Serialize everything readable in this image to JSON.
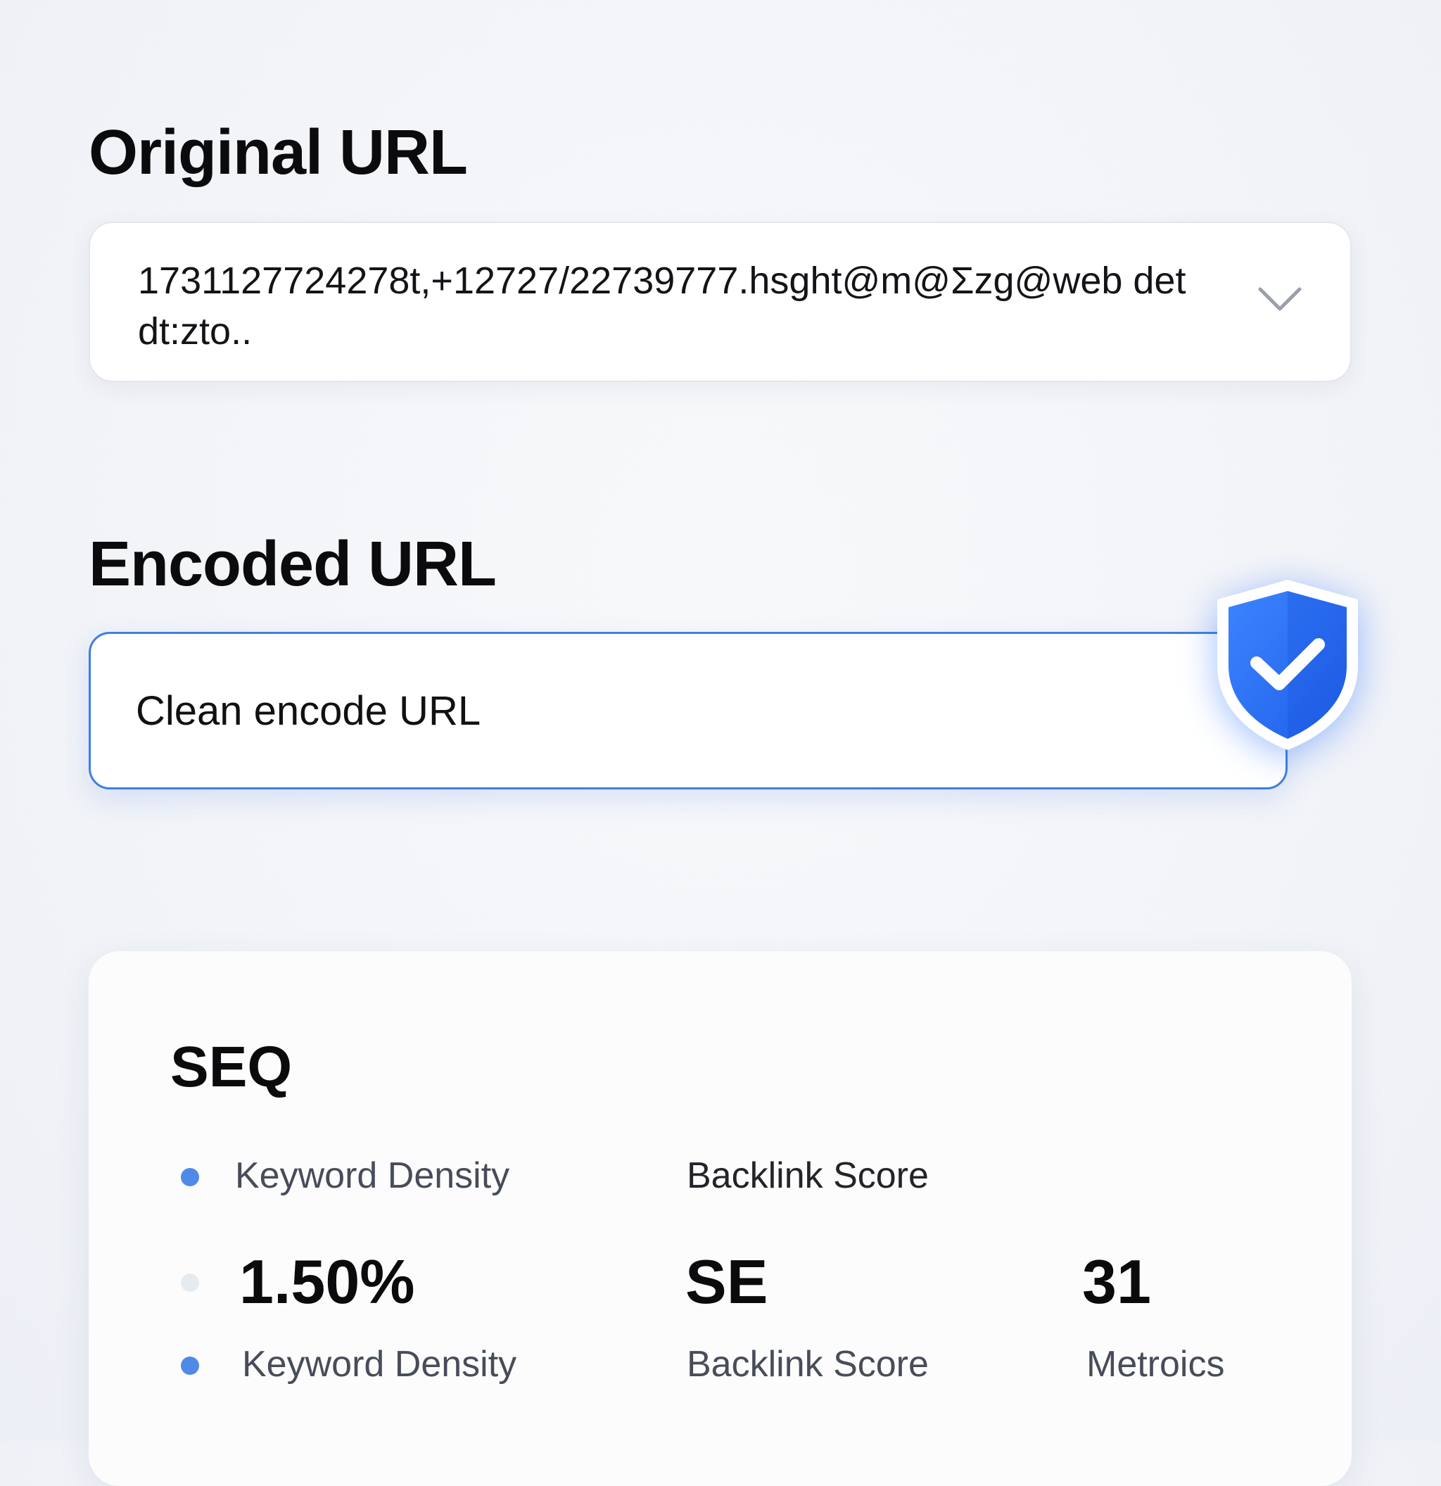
{
  "original": {
    "title": "Original URL",
    "value": "1731127724278t,+12727/22739777.hsght@m@Σzg@web detdt:zto.."
  },
  "encoded": {
    "title": "Encoded URL",
    "value": "Clean encode URL",
    "accent_color": "#3f7fe0",
    "badge_icon": "shield-check-icon"
  },
  "seo": {
    "title": "SEQ",
    "header_labels": {
      "keyword_density": "Keyword Density",
      "backlink_score": "Backlink Score"
    },
    "values": {
      "keyword_density": "1.50%",
      "backlink_score": "SE",
      "metrics": "31"
    },
    "labels": {
      "keyword_density": "Keyword Density",
      "backlink_score": "Backlink Score",
      "metrics": "Metroics"
    },
    "dot_color": "#4f8ae9"
  }
}
